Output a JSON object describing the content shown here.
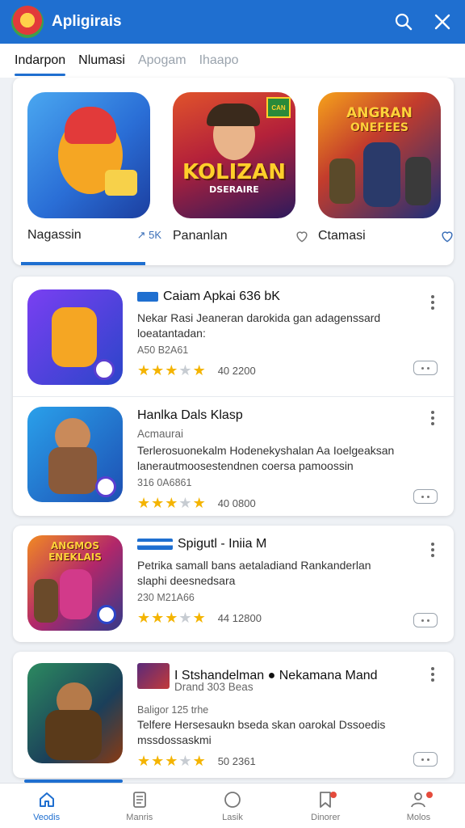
{
  "app": {
    "title": "Apligirais"
  },
  "tabs": [
    {
      "label": "Indarpon",
      "active": true
    },
    {
      "label": "Nlumasi",
      "active": false
    },
    {
      "label": "Apogam",
      "active": false
    },
    {
      "label": "Ihaapo",
      "active": false
    }
  ],
  "featured": [
    {
      "label": "Nagassin",
      "meta": "↗ 5K",
      "art_text": ""
    },
    {
      "label": "Pananlan",
      "meta": "",
      "art_text": "KOLIZAN",
      "art_subtext": "DSERAIRE",
      "badge": "CAN"
    },
    {
      "label": "Ctamasi",
      "meta": "",
      "art_text": "ANGRAN",
      "art_subtext": "ONEFEES"
    }
  ],
  "list": [
    {
      "title": "Caiam Apkai 636 bK",
      "subtitle": "",
      "desc_line1": "Nekar Rasi Jeaneran darokida gan adagenssard",
      "desc_line2": "loeatantadan:",
      "date": "A50 B2A61",
      "rating": "40 2200",
      "stars_on": 4
    },
    {
      "title": "Hanlka Dals Klasp",
      "subtitle": "Acmaurai",
      "desc_line1": "Terlerosuonekalm Hodenekyshalan Aa Ioelgeaksan",
      "desc_line2": "lanerautmoosestendnen coersa pamoossin",
      "date": "316 0A6861",
      "rating": "40 0800",
      "stars_on": 4
    },
    {
      "title": "Spigutl - Iniia M",
      "subtitle": "",
      "desc_line1": "Petrika samall bans aetaladiand Rankanderlan",
      "desc_line2": "slaphi deesnedsara",
      "date": "230 M21A66",
      "rating": "44 12800",
      "stars_on": 4,
      "art_text": "ANGMOS",
      "art_subtext": "ENEKLAIS"
    },
    {
      "title": "I Stshandelman ● Nekamana Mand",
      "subtitle": "Drand 303 Beas",
      "desc_line1": "Baligor 125 trhe",
      "desc_line2": "Telfere Hersesaukn bseda skan oarokal Dssoedis",
      "desc_line3": "mssdossaskmi",
      "date": "",
      "rating": "50 2361",
      "stars_on": 4
    }
  ],
  "bottom_nav": [
    {
      "label": "Veodis",
      "active": true,
      "icon": "home-icon"
    },
    {
      "label": "Manris",
      "active": false,
      "icon": "document-icon"
    },
    {
      "label": "Lasik",
      "active": false,
      "icon": "circle-icon"
    },
    {
      "label": "Dinorer",
      "active": false,
      "icon": "bookmark-icon"
    },
    {
      "label": "Molos",
      "active": false,
      "icon": "profile-icon"
    }
  ],
  "colors": {
    "accent": "#1f6fd0",
    "star": "#f4b400"
  }
}
